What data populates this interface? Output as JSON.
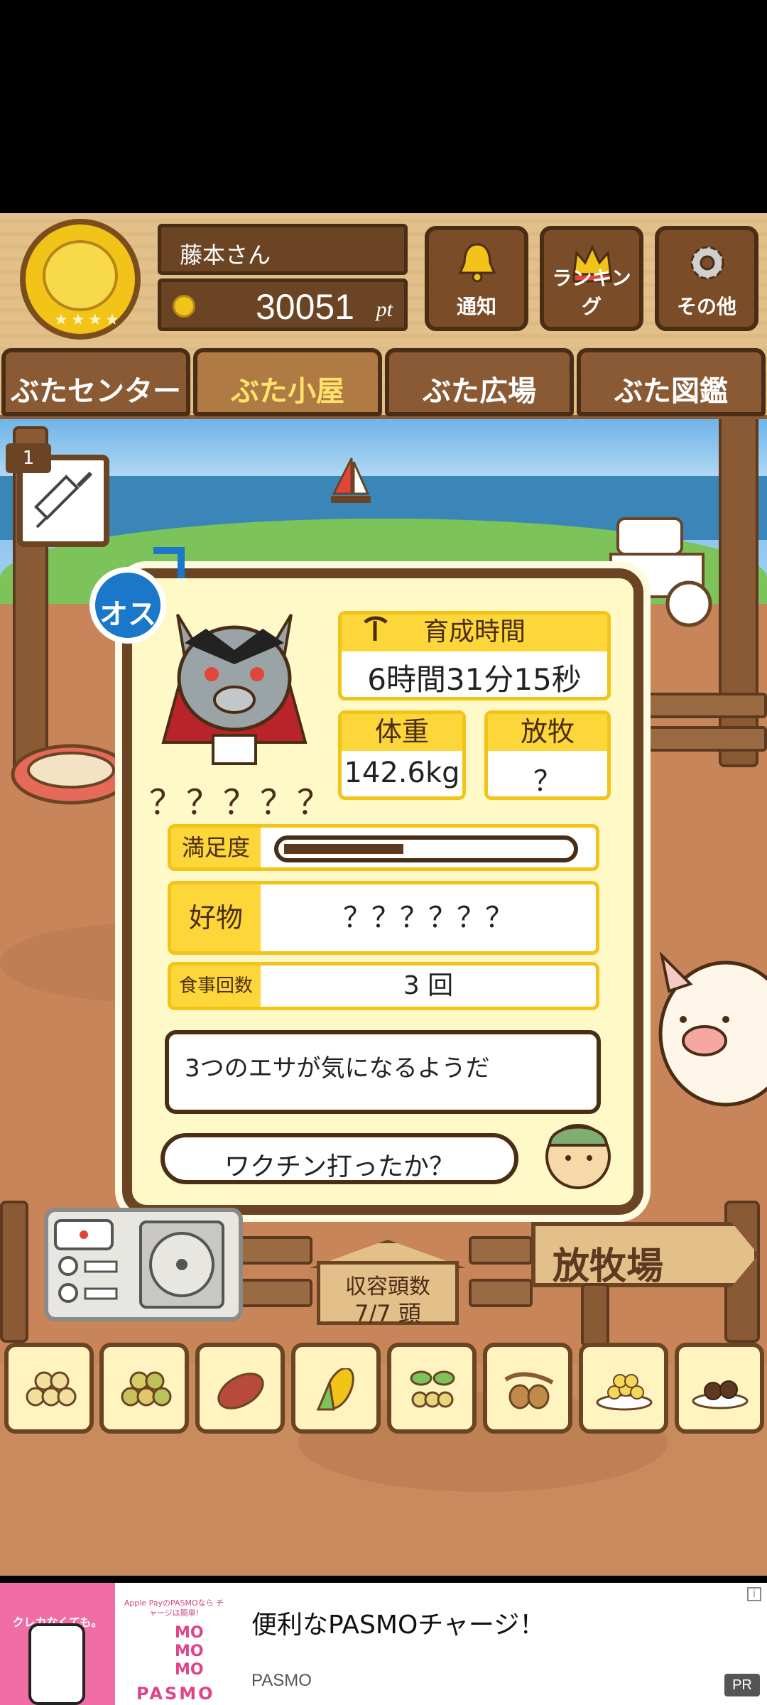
{
  "user": {
    "name": "藤本さん",
    "points": "30051",
    "points_unit": "pt"
  },
  "top_buttons": [
    {
      "label": "通知",
      "icon": "bell-icon"
    },
    {
      "label": "ランキング",
      "icon": "crown-icon"
    },
    {
      "label": "その他",
      "icon": "gear-icon"
    }
  ],
  "tabs": [
    {
      "label": "ぶたセンター"
    },
    {
      "label": "ぶた小屋",
      "active": true
    },
    {
      "label": "ぶた広場"
    },
    {
      "label": "ぶた図鑑"
    }
  ],
  "item_slot": {
    "count": "1",
    "icon": "syringe-icon"
  },
  "pig_card": {
    "gender_label": "オス",
    "name": "？？？？？",
    "breeding_time": {
      "label": "育成時間",
      "value": "6時間31分15秒"
    },
    "weight": {
      "label": "体重",
      "value": "142.6kg"
    },
    "grazing": {
      "label": "放牧",
      "value": "？"
    },
    "satisfaction": {
      "label": "満足度",
      "level": 0.42
    },
    "favorite": {
      "label": "好物",
      "value": "？？？？？？"
    },
    "meals": {
      "label": "食事回数",
      "value": "3 回"
    },
    "message": "3つのエサが気になるようだ",
    "question": "ワクチン打ったか？"
  },
  "capacity": {
    "label": "収容頭数",
    "value": "7/7 頭"
  },
  "pasture_sign": "放牧場",
  "food_items": [
    {
      "icon": "soybeans-icon"
    },
    {
      "icon": "mixed-beans-icon"
    },
    {
      "icon": "sweet-potato-icon"
    },
    {
      "icon": "corn-icon"
    },
    {
      "icon": "herb-seeds-icon"
    },
    {
      "icon": "acorn-icon"
    },
    {
      "icon": "grain-plate-icon"
    },
    {
      "icon": "chestnut-plate-icon"
    }
  ],
  "ad": {
    "image_text": "クレカなくても。",
    "logo_caption": "Apple PayのPASMOなら チャージは簡単!",
    "title": "便利なPASMOチャージ！",
    "advertiser": "PASMO",
    "badge": "PR"
  },
  "colors": {
    "wood_dark": "#6b4424",
    "accent_yellow": "#fdd63a",
    "male_blue": "#1a77c9",
    "ad_pink": "#f06da6"
  }
}
